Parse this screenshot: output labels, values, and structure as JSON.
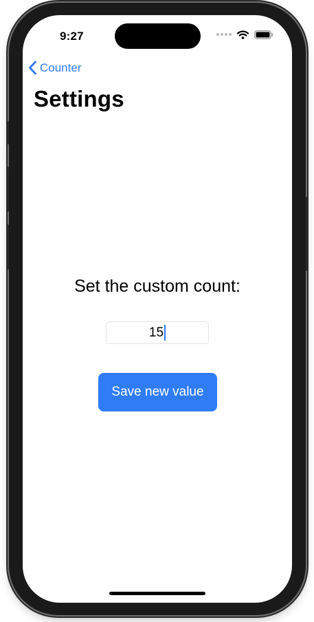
{
  "status_bar": {
    "time": "9:27"
  },
  "nav": {
    "back_label": "Counter"
  },
  "page": {
    "title": "Settings"
  },
  "form": {
    "prompt": "Set the custom count:",
    "count_value": "15",
    "save_label": "Save new value"
  },
  "colors": {
    "accent": "#2f7cf6",
    "background": "#ffffff",
    "text": "#000000"
  },
  "icons": {
    "back": "chevron-left-icon",
    "signal": "cellular-signal-icon",
    "wifi": "wifi-icon",
    "battery": "battery-icon"
  }
}
